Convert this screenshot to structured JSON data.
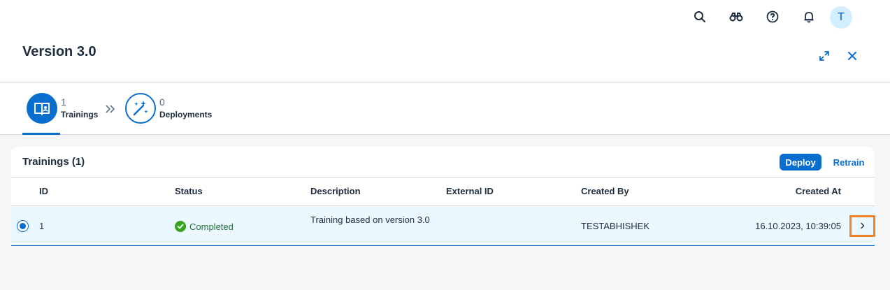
{
  "shell": {
    "avatar_initial": "T"
  },
  "header": {
    "title": "Version 3.0"
  },
  "steps": [
    {
      "count": "1",
      "label": "Trainings"
    },
    {
      "count": "0",
      "label": "Deployments"
    }
  ],
  "card": {
    "title": "Trainings (1)",
    "deploy_label": "Deploy",
    "retrain_label": "Retrain"
  },
  "table": {
    "columns": [
      "ID",
      "Status",
      "Description",
      "External ID",
      "Created By",
      "Created At"
    ],
    "rows": [
      {
        "id": "1",
        "status": "Completed",
        "description": "Training based on version 3.0",
        "external_id": "",
        "created_by": "TESTABHISHEK",
        "created_at": "16.10.2023, 10:39:05"
      }
    ]
  },
  "colors": {
    "accent": "#0a6ed1",
    "status_success": "#36a41d",
    "highlight_border": "#f0832a",
    "selected_row": "#ebf8ff"
  },
  "icons": [
    "search-icon",
    "binoculars-icon",
    "help-icon",
    "bell-icon",
    "fullscreen-icon",
    "close-icon",
    "training-icon",
    "chevron-double-right-icon",
    "deployment-icon",
    "check-circle-icon",
    "chevron-right-icon"
  ]
}
